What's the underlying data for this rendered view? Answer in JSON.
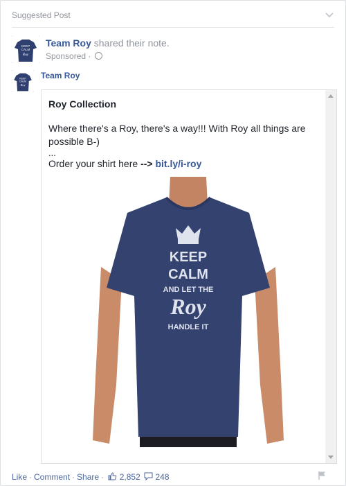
{
  "header": {
    "title": "Suggested Post"
  },
  "post": {
    "author": "Team Roy",
    "action_text": "shared their",
    "note_link": "note",
    "period": ".",
    "sponsored": "Sponsored",
    "sep": "·"
  },
  "note": {
    "author": "Team Roy",
    "title": "Roy Collection",
    "line1": " Where there's a Roy, there's a way!!! With Roy all things are possible B-)",
    "ellipsis": "...",
    "order_text": "Order your shirt here ",
    "arrow": " -->",
    "link": "bit.ly/i-roy"
  },
  "shirt": {
    "line1": "KEEP",
    "line2": "CALM",
    "line3": "AND LET THE",
    "line4": "Roy",
    "line5": "HANDLE IT"
  },
  "avatar_text": {
    "a": "KEEP",
    "b": "CALM",
    "c": "Roy"
  },
  "actions": {
    "like": "Like",
    "comment": "Comment",
    "share": "Share",
    "dot": "·",
    "likes_count": "2,852",
    "comments_count": "248"
  },
  "colors": {
    "link": "#365899",
    "shirt": "#2f3f6f",
    "muted": "#90949c"
  }
}
